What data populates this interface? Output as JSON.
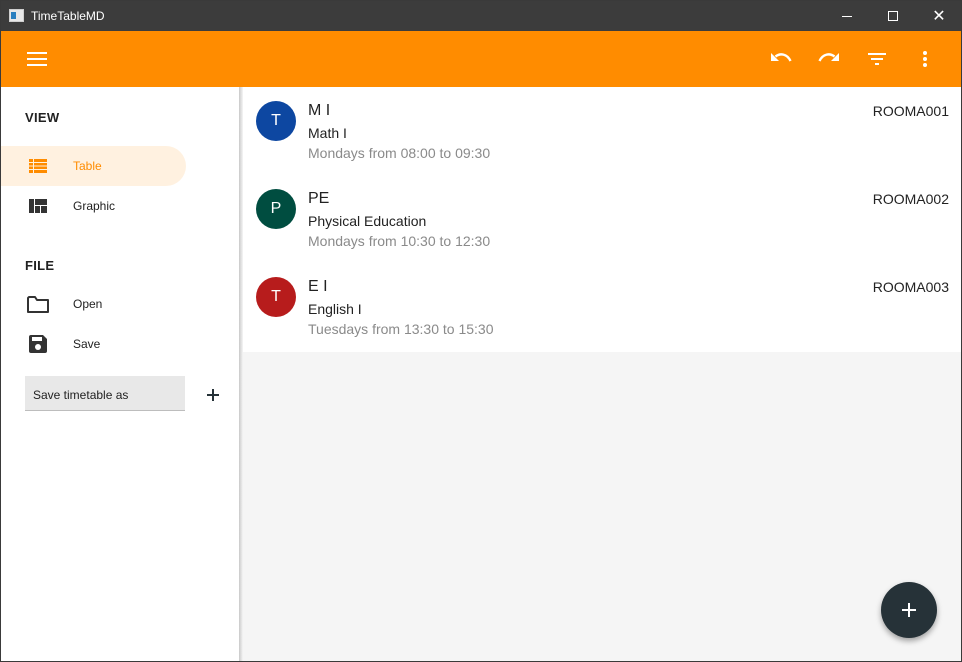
{
  "window": {
    "title": "TimeTableMD"
  },
  "appbar": {
    "icons": [
      "menu-icon",
      "undo-icon",
      "redo-icon",
      "filter-icon",
      "more-vert-icon"
    ],
    "color": "#ff8c00"
  },
  "sidebar": {
    "view_header": "VIEW",
    "file_header": "FILE",
    "view_items": [
      {
        "label": "Table",
        "icon": "table-icon",
        "active": true
      },
      {
        "label": "Graphic",
        "icon": "dashboard-icon",
        "active": false
      }
    ],
    "file_items": [
      {
        "label": "Open",
        "icon": "folder-icon"
      },
      {
        "label": "Save",
        "icon": "save-icon"
      }
    ],
    "save_as_placeholder": "Save timetable as"
  },
  "list": {
    "items": [
      {
        "initial": "T",
        "title": "M I",
        "subtitle": "Math I",
        "schedule": "Mondays from 08:00 to 09:30",
        "room": "ROOMA001",
        "avatar_color": "#0d47a1"
      },
      {
        "initial": "P",
        "title": "PE",
        "subtitle": "Physical Education",
        "schedule": "Mondays from 10:30 to 12:30",
        "room": "ROOMA002",
        "avatar_color": "#004d40"
      },
      {
        "initial": "T",
        "title": "E I",
        "subtitle": "English I",
        "schedule": "Tuesdays from 13:30 to 15:30",
        "room": "ROOMA003",
        "avatar_color": "#b71c1c"
      }
    ]
  },
  "fab": {
    "icon": "add-icon"
  }
}
